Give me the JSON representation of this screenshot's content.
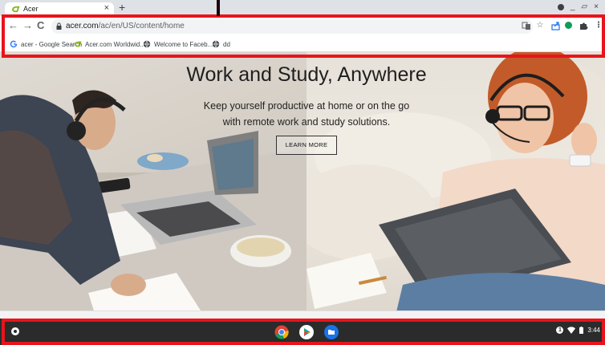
{
  "browser": {
    "tab": {
      "title": "Acer",
      "close_glyph": "×"
    },
    "new_tab_glyph": "+",
    "nav": {
      "back_glyph": "←",
      "forward_glyph": "→",
      "reload_glyph": "C"
    },
    "url": {
      "host": "acer.com",
      "path": "/ac/en/US/content/home"
    },
    "window_controls": {
      "minimize_glyph": "_",
      "restore_glyph": "▱",
      "close_glyph": "×"
    },
    "bookmarks": [
      {
        "label": "acer - Google Search",
        "icon": "google-icon"
      },
      {
        "label": "Acer.com Worldwid...",
        "icon": "acer-icon"
      },
      {
        "label": "Welcome to Faceb...",
        "icon": "globe-icon"
      },
      {
        "label": "dd",
        "icon": "globe-icon"
      }
    ]
  },
  "hero": {
    "title": "Work and Study, Anywhere",
    "subtitle_line1": "Keep yourself productive at home or on the go",
    "subtitle_line2": "with remote work and study solutions.",
    "cta_label": "LEARN MORE"
  },
  "shelf": {
    "apps": [
      "chrome-icon",
      "play-store-icon",
      "files-icon"
    ],
    "notification_badge": "1",
    "time": "3:44"
  },
  "colors": {
    "annotation_red": "#e8141c",
    "shelf_bg": "#2b2b2b",
    "acer_green": "#83b81a"
  }
}
